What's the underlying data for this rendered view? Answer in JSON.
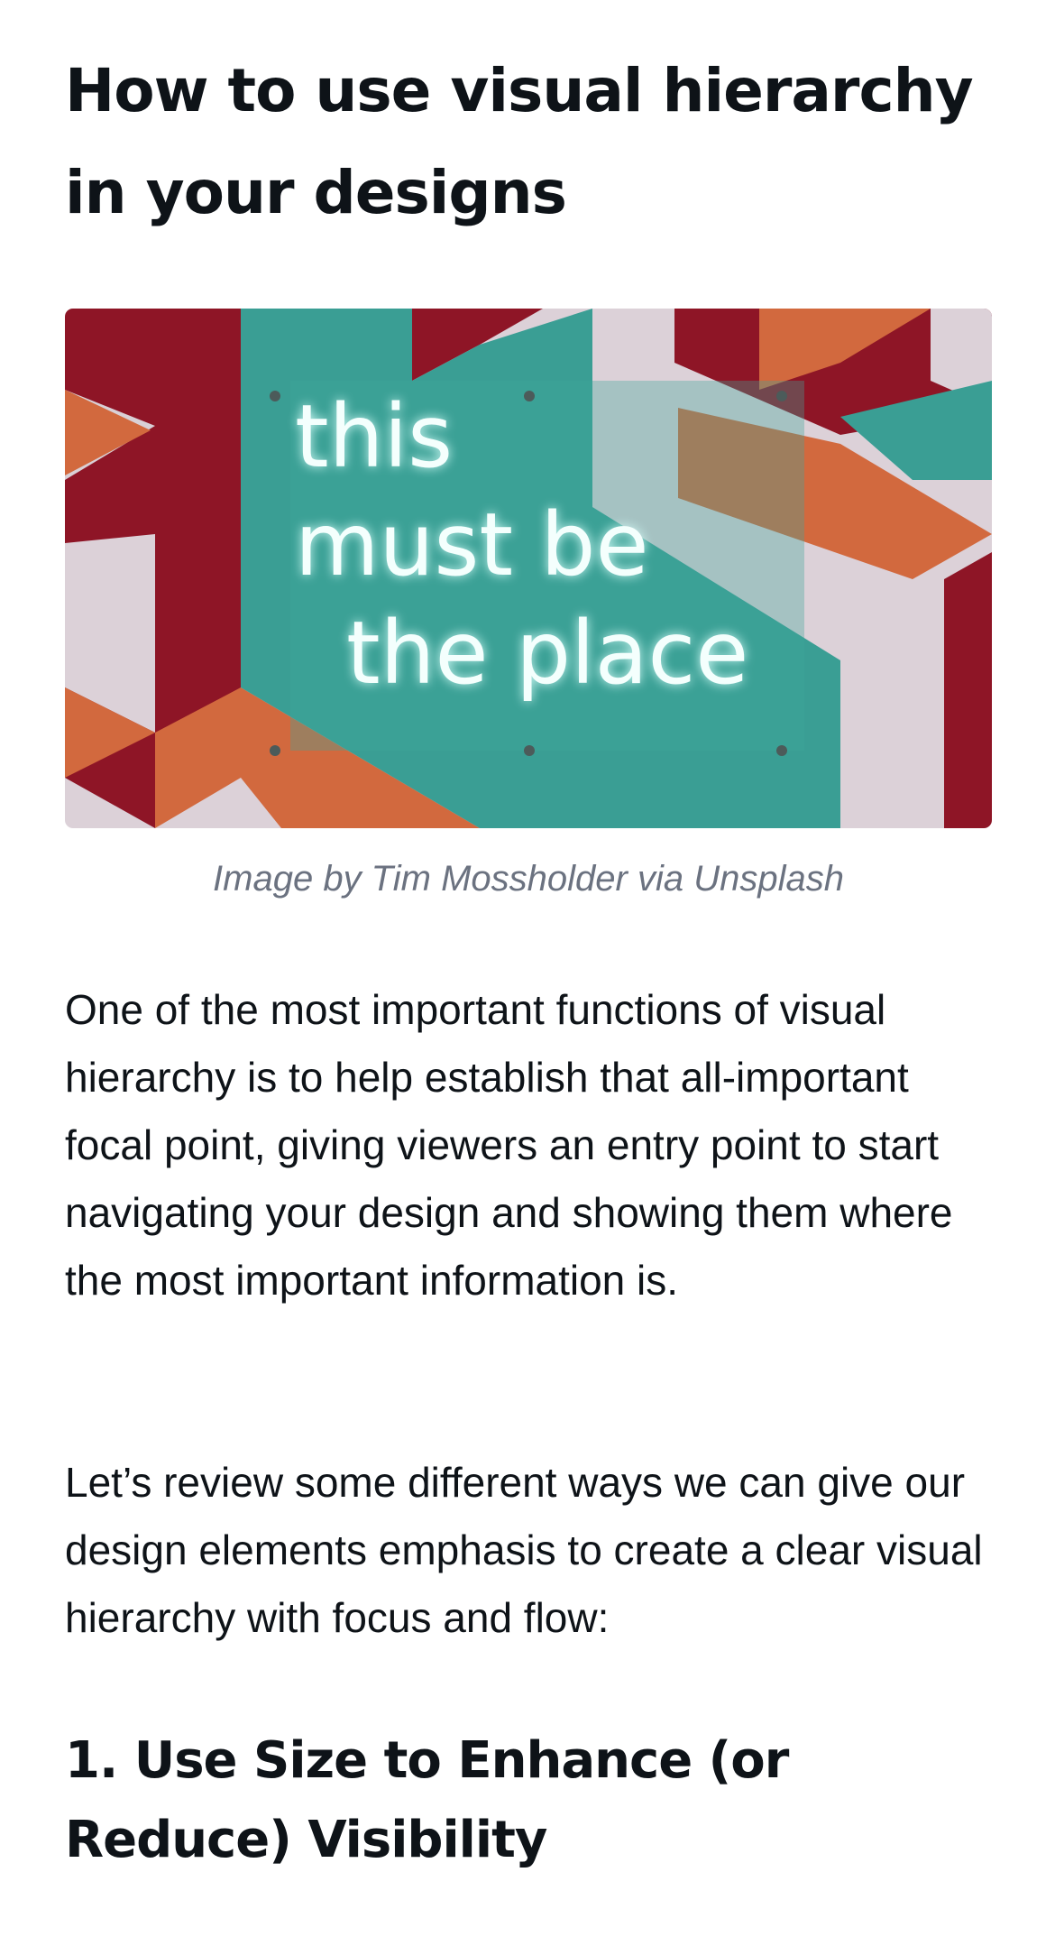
{
  "article": {
    "title": "How to use visual hierarchy in your designs",
    "image": {
      "alt": "Neon sign reading this must be the place",
      "neon_lines": [
        "this",
        "must be",
        "the place"
      ],
      "caption": "Image by Tim Mossholder via Unsplash"
    },
    "paragraphs": [
      "One of the most important functions of visual hierarchy is to help establish that all-important focal point, giving viewers an entry point to start navigating your design and showing them where the most important information is.",
      "Let’s review some different ways we can give our design elements emphasis to create a clear visual hierarchy with focus and flow:"
    ],
    "section_heading": "1. Use Size to Enhance (or Reduce) Visibility"
  },
  "colors": {
    "text": "#0e1318",
    "caption": "#6b7280",
    "teal": "#3a9e94",
    "crimson": "#8e1526",
    "orange": "#d2693e",
    "lilac": "#dcd1d8"
  }
}
